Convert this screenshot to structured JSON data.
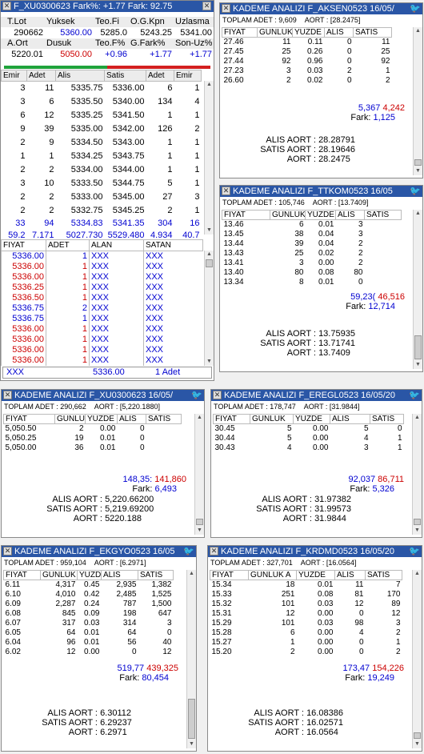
{
  "main": {
    "title": "F_XU0300623 Fark%: +1.77  Fark: 92.75",
    "info_row1_labels": [
      "T.Lot",
      "Yuksek",
      "Teo.Fi",
      "O.G.Kpn",
      "Uzlasma"
    ],
    "info_row1_values": [
      "290662",
      "5360.00",
      "5285.0",
      "5243.25",
      "5341.00"
    ],
    "info_row2_labels": [
      "A.Ort",
      "Dusuk",
      "Teo.F%",
      "G.Fark%",
      "Son-Uz%"
    ],
    "info_row2_values": [
      "5220.01",
      "5050.00",
      "+0.96",
      "+1.77",
      "+1.77"
    ],
    "book_headers": [
      "Emir",
      "Adet",
      "Alis",
      "Satis",
      "Adet",
      "Emir"
    ],
    "book_rows": [
      [
        "3",
        "11",
        "5335.75",
        "5336.00",
        "6",
        "1"
      ],
      [
        "3",
        "6",
        "5335.50",
        "5340.00",
        "134",
        "4"
      ],
      [
        "6",
        "12",
        "5335.25",
        "5341.50",
        "1",
        "1"
      ],
      [
        "9",
        "39",
        "5335.00",
        "5342.00",
        "126",
        "2"
      ],
      [
        "2",
        "9",
        "5334.50",
        "5343.00",
        "1",
        "1"
      ],
      [
        "1",
        "1",
        "5334.25",
        "5343.75",
        "1",
        "1"
      ],
      [
        "2",
        "2",
        "5334.00",
        "5344.00",
        "1",
        "1"
      ],
      [
        "3",
        "10",
        "5333.50",
        "5344.75",
        "5",
        "1"
      ],
      [
        "2",
        "2",
        "5333.00",
        "5345.00",
        "27",
        "3"
      ],
      [
        "2",
        "2",
        "5332.75",
        "5345.25",
        "2",
        "1"
      ]
    ],
    "book_total": [
      "33",
      "94",
      "5334.83",
      "5341.35",
      "304",
      "16"
    ],
    "book_summary": [
      "59.2",
      "7.171",
      "5027.730",
      "5529.480",
      "4.934",
      "40.7"
    ],
    "trade_headers": [
      "FIYAT",
      "ADET",
      "ALAN",
      "SATAN"
    ],
    "trades": [
      {
        "price": "5336.00",
        "qty": "1",
        "buyer": "XXX",
        "seller": "XXX",
        "color": "blue"
      },
      {
        "price": "5336.00",
        "qty": "1",
        "buyer": "XXX",
        "seller": "XXX",
        "color": "red"
      },
      {
        "price": "5336.00",
        "qty": "1",
        "buyer": "XXX",
        "seller": "XXX",
        "color": "red"
      },
      {
        "price": "5336.25",
        "qty": "1",
        "buyer": "XXX",
        "seller": "XXX",
        "color": "red"
      },
      {
        "price": "5336.50",
        "qty": "1",
        "buyer": "XXX",
        "seller": "XXX",
        "color": "red"
      },
      {
        "price": "5336.75",
        "qty": "2",
        "buyer": "XXX",
        "seller": "XXX",
        "color": "blue"
      },
      {
        "price": "5336.75",
        "qty": "1",
        "buyer": "XXX",
        "seller": "XXX",
        "color": "blue"
      },
      {
        "price": "5336.00",
        "qty": "1",
        "buyer": "XXX",
        "seller": "XXX",
        "color": "red"
      },
      {
        "price": "5336.00",
        "qty": "1",
        "buyer": "XXX",
        "seller": "XXX",
        "color": "red"
      },
      {
        "price": "5336.00",
        "qty": "1",
        "buyer": "XXX",
        "seller": "XXX",
        "color": "red"
      },
      {
        "price": "5336.00",
        "qty": "1",
        "buyer": "XXX",
        "seller": "XXX",
        "color": "red"
      }
    ],
    "last_trade": {
      "party": "XXX",
      "price": "5336.00",
      "qty": "1 Adet"
    }
  },
  "panels": {
    "akse": {
      "title": "KADEME ANALIZI F_AKSEN0523 16/05/",
      "toplam_label": "TOPLAM ADET : 9,609",
      "aort_label": "AORT :  [28.2475]",
      "headers": [
        "FIYAT",
        "GUNLUK",
        "YUZDE",
        "ALIS",
        "SATIS"
      ],
      "rows": [
        [
          "27.46",
          "11",
          "0.11",
          "0",
          "11"
        ],
        [
          "27.45",
          "25",
          "0.26",
          "0",
          "25"
        ],
        [
          "27.44",
          "92",
          "0.96",
          "0",
          "92"
        ],
        [
          "27.23",
          "3",
          "0.03",
          "2",
          "1"
        ],
        [
          "26.60",
          "2",
          "0.02",
          "0",
          "2"
        ]
      ],
      "alis_total": "5,367",
      "satis_total": "4,242",
      "fark_label": "Fark:",
      "fark_value": "1,125",
      "alis_aort_label": "ALIS AORT :",
      "alis_aort": "28.28791",
      "satis_aort_label": "SATIS AORT :",
      "satis_aort": "28.19646",
      "aort_label2": "AORT :",
      "aort": "28.2475"
    },
    "ttkom": {
      "title": "KADEME ANALIZI F_TTKOM0523 16/05",
      "toplam_label": "TOPLAM ADET : 105,746",
      "aort_label": "AORT :  [13.7409]",
      "headers": [
        "FIYAT",
        "GUNLUK",
        "YUZDE",
        "ALIS",
        "SATIS"
      ],
      "rows": [
        [
          "13.46",
          "6",
          "0.01",
          "3",
          ""
        ],
        [
          "13.45",
          "38",
          "0.04",
          "3",
          ""
        ],
        [
          "13.44",
          "39",
          "0.04",
          "2",
          ""
        ],
        [
          "13.43",
          "25",
          "0.02",
          "2",
          ""
        ],
        [
          "13.41",
          "3",
          "0.00",
          "2",
          ""
        ],
        [
          "13.40",
          "80",
          "0.08",
          "80",
          ""
        ],
        [
          "13.34",
          "8",
          "0.01",
          "0",
          ""
        ]
      ],
      "alis_total": "59,23(",
      "satis_total": "46,516",
      "fark_label": "Fark:",
      "fark_value": "12,714",
      "alis_aort_label": "ALIS AORT :",
      "alis_aort": "13.75935",
      "satis_aort_label": "SATIS AORT :",
      "satis_aort": "13.71741",
      "aort_label2": "AORT :",
      "aort": "13.7409"
    },
    "xu030": {
      "title": "KADEME ANALIZI F_XU0300623 16/05/",
      "toplam_label": "TOPLAM ADET : 290,662",
      "aort_label": "AORT :  [5,220.1880]",
      "headers": [
        "FIYAT",
        "GUNLU",
        "YUZDE",
        "ALIS",
        "SATIS"
      ],
      "rows": [
        [
          "5,050.50",
          "2",
          "0.00",
          "0",
          ""
        ],
        [
          "5,050.25",
          "19",
          "0.01",
          "0",
          ""
        ],
        [
          "5,050.00",
          "36",
          "0.01",
          "0",
          ""
        ]
      ],
      "alis_total": "148,35:",
      "satis_total": "141,860",
      "fark_label": "Fark:",
      "fark_value": "6,493",
      "alis_aort_label": "ALIS AORT :",
      "alis_aort": "5,220.66200",
      "satis_aort_label": "SATIS AORT :",
      "satis_aort": "5,219.69200",
      "aort_label2": "AORT :",
      "aort": "5220.188"
    },
    "eregl": {
      "title": "KADEME ANALIZI F_EREGL0523 16/05/20",
      "toplam_label": "TOPLAM ADET : 178,747",
      "aort_label": "AORT :  [31.9844]",
      "headers": [
        "FIYAT",
        "GUNLUK",
        "YUZDE",
        "ALIS",
        "SATIS"
      ],
      "rows": [
        [
          "30.45",
          "5",
          "0.00",
          "5",
          "0"
        ],
        [
          "30.44",
          "5",
          "0.00",
          "4",
          "1"
        ],
        [
          "30.43",
          "4",
          "0.00",
          "3",
          "1"
        ]
      ],
      "alis_total": "92,037",
      "satis_total": "86,711",
      "fark_label": "Fark:",
      "fark_value": "5,326",
      "alis_aort_label": "ALIS AORT :",
      "alis_aort": "31.97382",
      "satis_aort_label": "SATIS AORT :",
      "satis_aort": "31.99573",
      "aort_label2": "AORT :",
      "aort": "31.9844"
    },
    "ekgyo": {
      "title": "KADEME ANALIZI F_EKGYO0523 16/05",
      "toplam_label": "TOPLAM ADET : 959,104",
      "aort_label": "AORT :  [6.2971]",
      "headers": [
        "FIYAT",
        "GUNLUK",
        "YUZDE",
        "ALIS",
        "SATIS"
      ],
      "rows": [
        [
          "6.11",
          "4,317",
          "0.45",
          "2,935",
          "1,382"
        ],
        [
          "6.10",
          "4,010",
          "0.42",
          "2,485",
          "1,525"
        ],
        [
          "6.09",
          "2,287",
          "0.24",
          "787",
          "1,500"
        ],
        [
          "6.08",
          "845",
          "0.09",
          "198",
          "647"
        ],
        [
          "6.07",
          "317",
          "0.03",
          "314",
          "3"
        ],
        [
          "6.05",
          "64",
          "0.01",
          "64",
          "0"
        ],
        [
          "6.04",
          "96",
          "0.01",
          "56",
          "40"
        ],
        [
          "6.02",
          "12",
          "0.00",
          "0",
          "12"
        ]
      ],
      "alis_total": "519,77",
      "satis_total": "439,325",
      "fark_label": "Fark:",
      "fark_value": "80,454",
      "alis_aort_label": "ALIS AORT :",
      "alis_aort": "6.30112",
      "satis_aort_label": "SATIS AORT :",
      "satis_aort": "6.29237",
      "aort_label2": "AORT :",
      "aort": "6.2971"
    },
    "krdmd": {
      "title": "KADEME ANALIZI F_KRDMD0523 16/05/20",
      "toplam_label": "TOPLAM ADET : 327,701",
      "aort_label": "AORT :  [16.0564]",
      "headers": [
        "FIYAT",
        "GUNLUK A",
        "YUZDE",
        "ALIS",
        "SATIS"
      ],
      "rows": [
        [
          "15.34",
          "18",
          "0.01",
          "11",
          "7"
        ],
        [
          "15.33",
          "251",
          "0.08",
          "81",
          "170"
        ],
        [
          "15.32",
          "101",
          "0.03",
          "12",
          "89"
        ],
        [
          "15.31",
          "12",
          "0.00",
          "0",
          "12"
        ],
        [
          "15.29",
          "101",
          "0.03",
          "98",
          "3"
        ],
        [
          "15.28",
          "6",
          "0.00",
          "4",
          "2"
        ],
        [
          "15.27",
          "1",
          "0.00",
          "0",
          "1"
        ],
        [
          "15.20",
          "2",
          "0.00",
          "0",
          "2"
        ]
      ],
      "alis_total": "173,47",
      "satis_total": "154,226",
      "fark_label": "Fark:",
      "fark_value": "19,249",
      "alis_aort_label": "ALIS AORT :",
      "alis_aort": "16.08386",
      "satis_aort_label": "SATIS AORT :",
      "satis_aort": "16.02571",
      "aort_label2": "AORT :",
      "aort": "16.0564"
    }
  }
}
